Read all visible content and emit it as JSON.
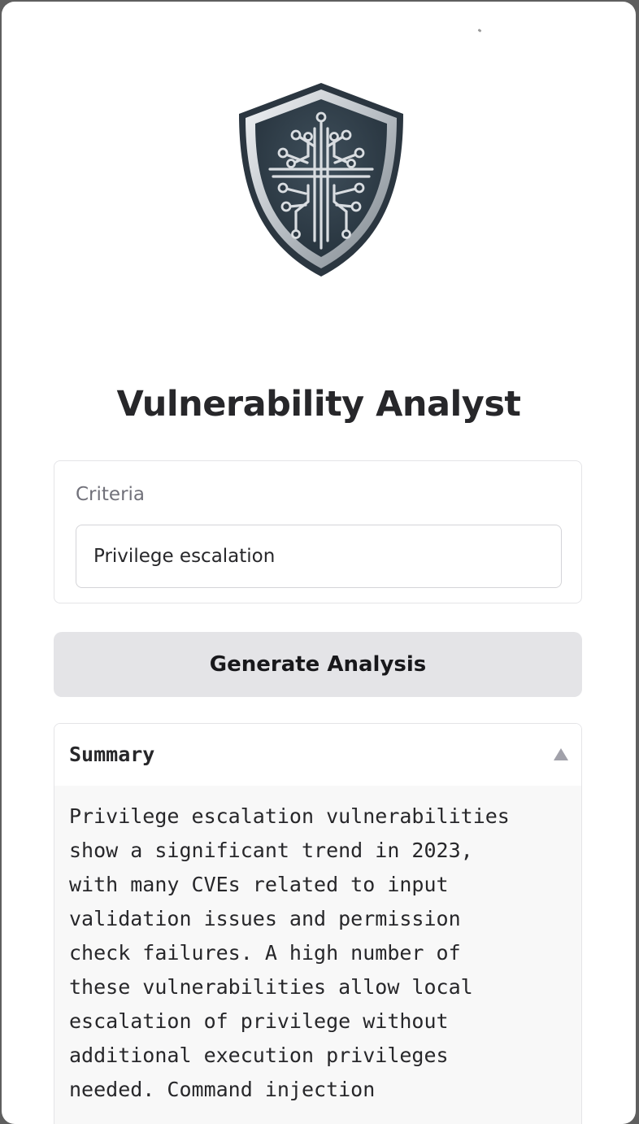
{
  "app": {
    "title": "Vulnerability Analyst",
    "logo_icon": "shield-circuit-icon"
  },
  "criteria": {
    "label": "Criteria",
    "value": "Privilege escalation"
  },
  "generate_button": {
    "label": "Generate Analysis"
  },
  "summary": {
    "title": "Summary",
    "expanded": true,
    "toggle_icon": "triangle-up-icon",
    "text": "Privilege escalation vulnerabilities\nshow a significant trend in 2023,\nwith many CVEs related to input\nvalidation issues and permission\ncheck failures. A high number of\nthese vulnerabilities allow local\nescalation of privilege without\nadditional execution privileges\nneeded. Command injection"
  },
  "colors": {
    "title_text": "#27272a",
    "button_bg": "#e4e4e7",
    "card_border": "#e4e4e7",
    "summary_body_bg": "#f8f8f8",
    "shield_dark": "#2d3a45",
    "shield_silver": "#c9ced3"
  }
}
